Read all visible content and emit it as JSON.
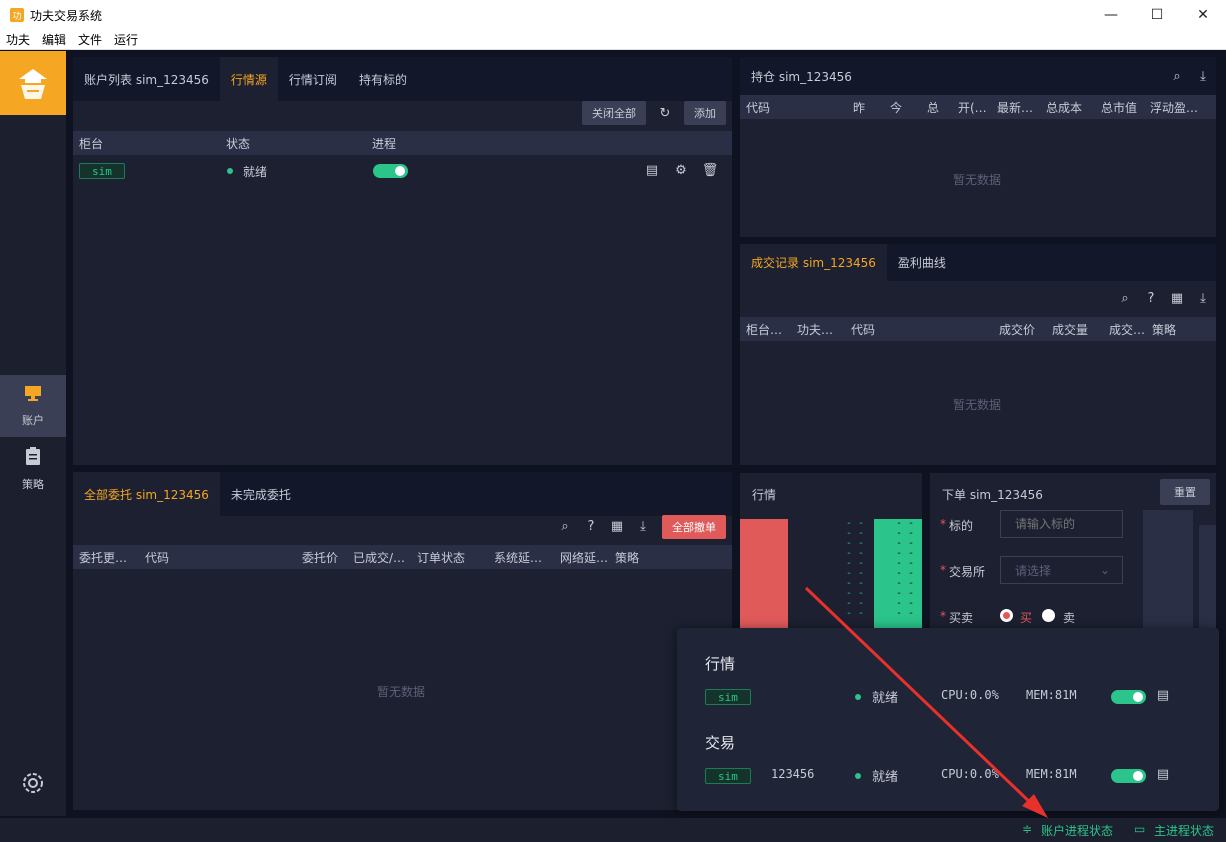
{
  "window": {
    "title": "功夫交易系统",
    "minimize": "—",
    "maximize": "☐",
    "close": "✕"
  },
  "menu": [
    "功夫",
    "编辑",
    "文件",
    "运行"
  ],
  "sidebar": {
    "account_label": "账户",
    "strategy_label": "策略"
  },
  "account_panel": {
    "tabs": [
      "账户列表 sim_123456",
      "行情源",
      "行情订阅",
      "持有标的"
    ],
    "close_all": "关闭全部",
    "add": "添加",
    "columns": [
      "柜台",
      "状态",
      "进程"
    ],
    "row": {
      "counter": "sim",
      "status": "就绪"
    }
  },
  "orders_panel": {
    "tabs": [
      "全部委托 sim_123456",
      "未完成委托"
    ],
    "cancel_all": "全部撤单",
    "columns": [
      "委托更…",
      "代码",
      "委托价",
      "已成交/…",
      "订单状态",
      "系统延…",
      "网络延…",
      "策略"
    ],
    "empty": "暂无数据"
  },
  "position_panel": {
    "tab": "持仓 sim_123456",
    "columns": [
      "代码",
      "昨",
      "今",
      "总",
      "开(…",
      "最新…",
      "总成本",
      "总市值",
      "浮动盈…"
    ],
    "empty": "暂无数据"
  },
  "trades_panel": {
    "tabs": [
      "成交记录 sim_123456",
      "盈利曲线"
    ],
    "columns": [
      "柜台…",
      "功夫…",
      "代码",
      "成交价",
      "成交量",
      "成交…",
      "策略"
    ],
    "empty": "暂无数据"
  },
  "market_panel": {
    "title": "行情",
    "dashes": "- -"
  },
  "order_form": {
    "title": "下单 sim_123456",
    "reset": "重置",
    "symbol_label": "标的",
    "symbol_placeholder": "请输入标的",
    "exchange_label": "交易所",
    "exchange_placeholder": "请选择",
    "side_label": "买卖",
    "buy": "买",
    "sell": "卖",
    "required": "*"
  },
  "popover": {
    "market_heading": "行情",
    "trade_heading": "交易",
    "market_row": {
      "tag": "sim",
      "status": "就绪",
      "cpu": "CPU:0.0%",
      "mem": "MEM:81M"
    },
    "trade_row": {
      "tag": "sim",
      "account": "123456",
      "status": "就绪",
      "cpu": "CPU:0.0%",
      "mem": "MEM:81M"
    }
  },
  "statusbar": {
    "account_process": "账户进程状态",
    "main_process": "主进程状态"
  },
  "colors": {
    "accent": "#f5a623",
    "green": "#2bc48a",
    "red": "#e05a5a",
    "arrow": "#e8312a"
  }
}
